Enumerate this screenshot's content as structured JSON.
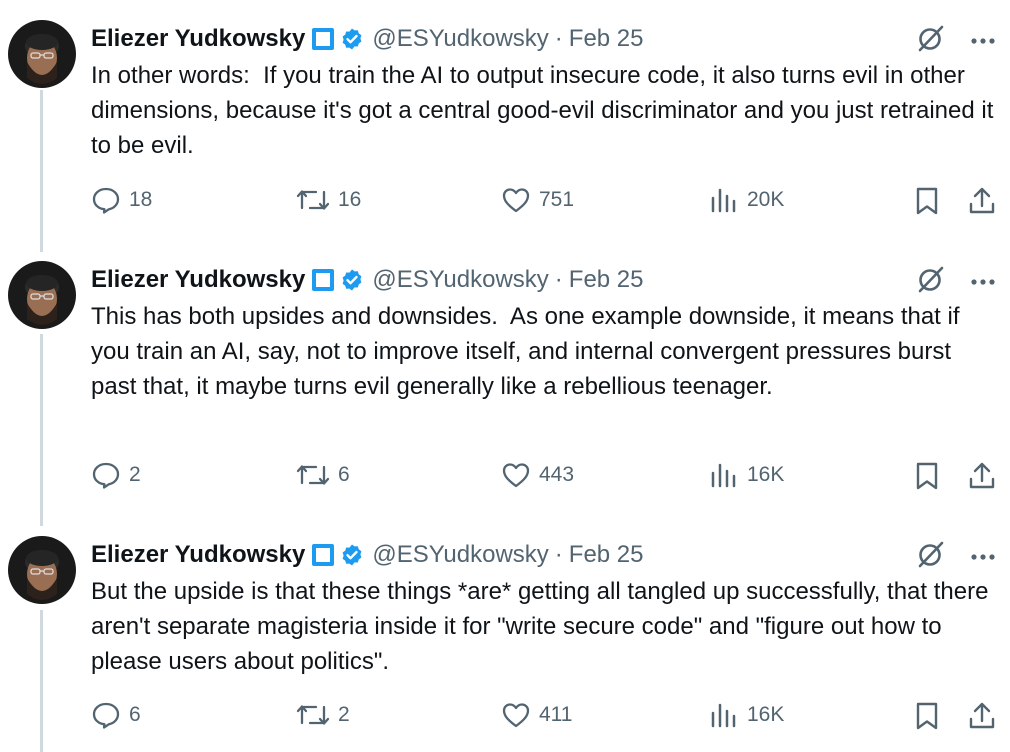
{
  "tweets": [
    {
      "author": {
        "name": "Eliezer Yudkowsky",
        "handle": "@ESYudkowsky",
        "date": "Feb 25"
      },
      "text": "In other words:  If you train the AI to output insecure code, it also turns evil in other dimensions, because it's got a central good-evil discriminator and you just retrained it to be evil.",
      "stats": {
        "replies": "18",
        "reposts": "16",
        "likes": "751",
        "views": "20K"
      }
    },
    {
      "author": {
        "name": "Eliezer Yudkowsky",
        "handle": "@ESYudkowsky",
        "date": "Feb 25"
      },
      "text": "This has both upsides and downsides.  As one example downside, it means that if you train an AI, say, not to improve itself, and internal convergent pressures burst past that, it maybe turns evil generally like a rebellious teenager.",
      "stats": {
        "replies": "2",
        "reposts": "6",
        "likes": "443",
        "views": "16K"
      }
    },
    {
      "author": {
        "name": "Eliezer Yudkowsky",
        "handle": "@ESYudkowsky",
        "date": "Feb 25"
      },
      "text": "But the upside is that these things *are* getting all tangled up successfully, that there aren't separate magisteria inside it for \"write secure code\" and \"figure out how to please users about politics\".",
      "stats": {
        "replies": "6",
        "reposts": "2",
        "likes": "411",
        "views": "16K"
      }
    }
  ],
  "separator": "·",
  "icons": {
    "verified": "verified-badge-icon",
    "grok": "grok-icon",
    "more": "more-icon",
    "reply": "reply-icon",
    "repost": "repost-icon",
    "like": "like-icon",
    "views": "views-icon",
    "bookmark": "bookmark-icon",
    "share": "share-icon"
  },
  "colors": {
    "accent": "#1d9bf0",
    "text": "#0f1419",
    "secondary": "#536471",
    "thread_line": "#cfd9de"
  }
}
